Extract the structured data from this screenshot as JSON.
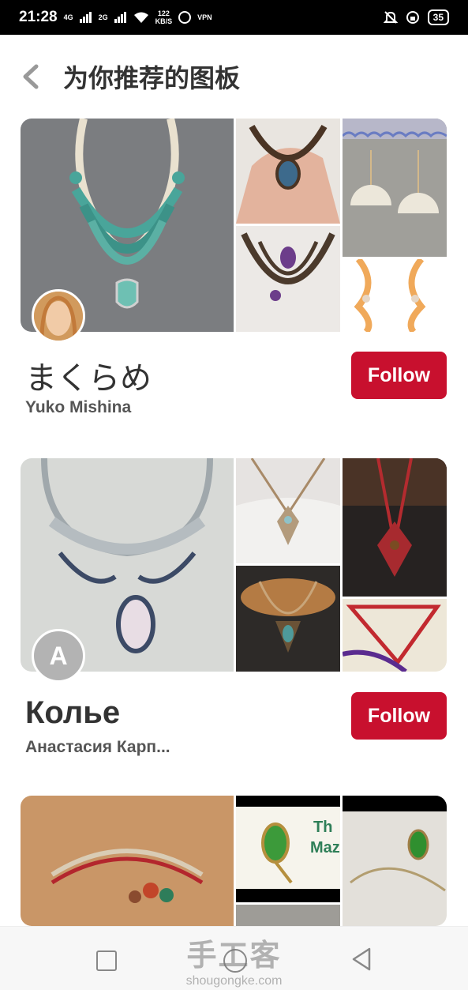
{
  "status": {
    "time": "21:28",
    "net1": "4G",
    "net2": "2G",
    "speed_value": "122",
    "speed_unit": "KB/S",
    "vpn": "VPN",
    "battery": "35"
  },
  "header": {
    "title": "为你推荐的图板"
  },
  "boards": [
    {
      "title": "まくらめ",
      "owner": "Yuko Mishina",
      "follow_label": "Follow"
    },
    {
      "title": "Колье",
      "owner": "Анастасия Карп...",
      "avatar_letter": "A",
      "follow_label": "Follow"
    },
    {
      "mosaic_text": "Th\nMaz"
    }
  ],
  "watermark": {
    "cn": "手工客",
    "en": "shougongke.com"
  },
  "colors": {
    "follow_bg": "#c8102e",
    "accent_teal": "#49a59a"
  }
}
